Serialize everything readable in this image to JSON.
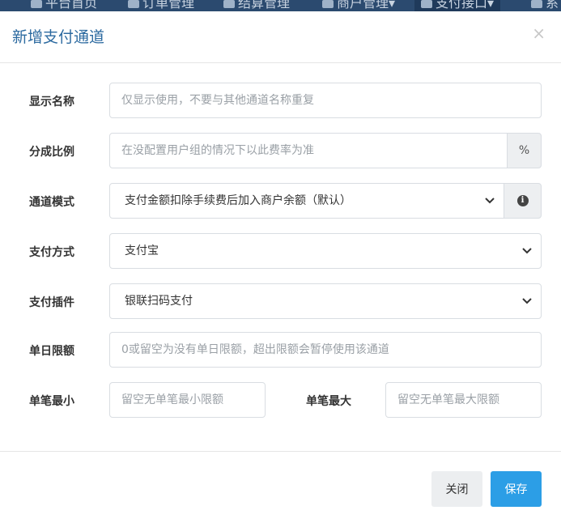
{
  "nav": {
    "items": [
      {
        "label": "平台首页"
      },
      {
        "label": "订单管理"
      },
      {
        "label": "结算管理"
      },
      {
        "label": "商户管理▾"
      },
      {
        "label": "支付接口▾"
      },
      {
        "label": "系"
      }
    ]
  },
  "modal": {
    "title": "新增支付通道",
    "close_symbol": "×"
  },
  "form": {
    "display_name": {
      "label": "显示名称",
      "placeholder": "仅显示使用，不要与其他通道名称重复"
    },
    "share_ratio": {
      "label": "分成比例",
      "placeholder": "在没配置用户组的情况下以此费率为准",
      "suffix": "%"
    },
    "channel_mode": {
      "label": "通道模式",
      "value": "支付金额扣除手续费后加入商户余额（默认）",
      "info_icon": "info-circle-icon"
    },
    "pay_method": {
      "label": "支付方式",
      "value": "支付宝"
    },
    "pay_plugin": {
      "label": "支付插件",
      "value": "银联扫码支付"
    },
    "daily_limit": {
      "label": "单日限额",
      "placeholder": "0或留空为没有单日限额，超出限额会暂停使用该通道"
    },
    "single_min": {
      "label": "单笔最小",
      "placeholder": "留空无单笔最小限额"
    },
    "single_max": {
      "label": "单笔最大",
      "placeholder": "留空无单笔最大限额"
    }
  },
  "footer": {
    "close_label": "关闭",
    "save_label": "保存"
  },
  "colors": {
    "title": "#2c6aa0",
    "primary_button": "#2c9ee6",
    "default_button": "#eceef0",
    "nav_bg": "#2b4a6f"
  }
}
